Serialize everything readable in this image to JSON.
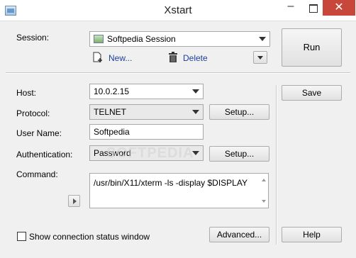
{
  "window": {
    "title": "Xstart"
  },
  "session": {
    "label": "Session:",
    "value": "Softpedia Session",
    "new_label": "New...",
    "delete_label": "Delete"
  },
  "buttons": {
    "run": "Run",
    "save": "Save",
    "help": "Help",
    "setup_protocol": "Setup...",
    "setup_auth": "Setup...",
    "advanced": "Advanced..."
  },
  "host": {
    "label": "Host:",
    "value": "10.0.2.15"
  },
  "protocol": {
    "label": "Protocol:",
    "value": "TELNET"
  },
  "username": {
    "label": "User Name:",
    "value": "Softpedia"
  },
  "authentication": {
    "label": "Authentication:",
    "value": "Password"
  },
  "command": {
    "label": "Command:",
    "value": "/usr/bin/X11/xterm -ls -display $DISPLAY"
  },
  "status_window": {
    "label": "Show connection status window",
    "checked": false
  },
  "watermark": "SOFTPEDIA"
}
